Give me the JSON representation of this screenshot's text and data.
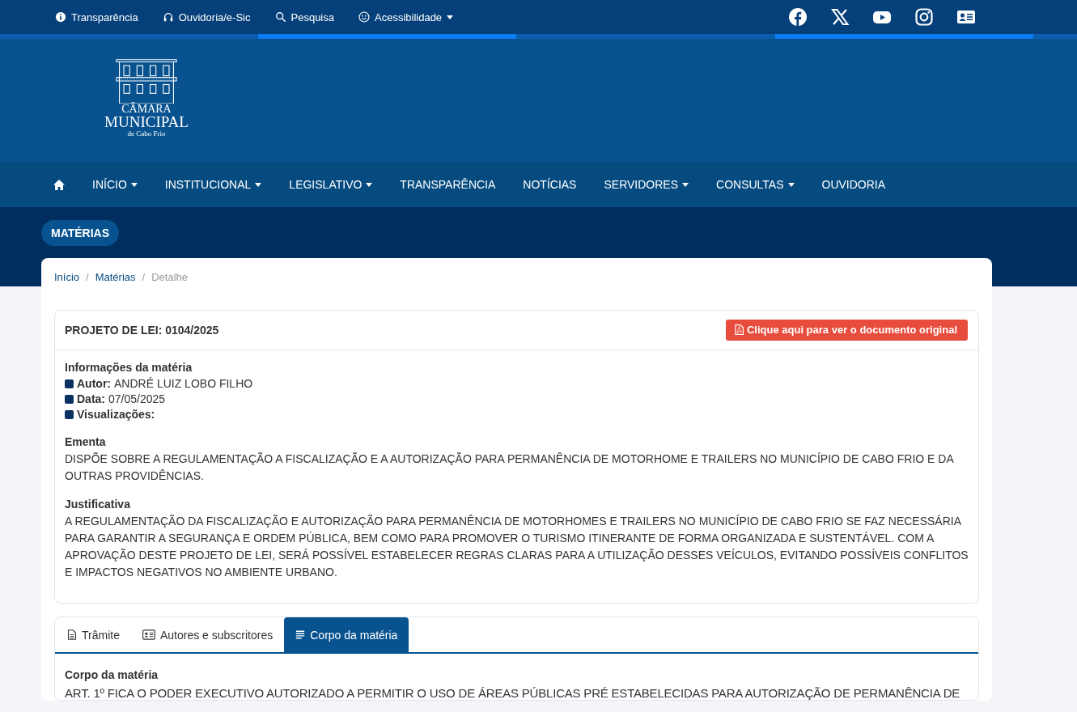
{
  "top_links": [
    {
      "kind": "info",
      "label": "Transparência",
      "has_dropdown": false
    },
    {
      "kind": "headset",
      "label": "Ouvidoria/e-Sic",
      "has_dropdown": false
    },
    {
      "kind": "search",
      "label": "Pesquisa",
      "has_dropdown": false
    },
    {
      "kind": "smile",
      "label": "Acessibilidade",
      "has_dropdown": true
    }
  ],
  "social": [
    {
      "kind": "facebook"
    },
    {
      "kind": "x"
    },
    {
      "kind": "youtube"
    },
    {
      "kind": "instagram"
    },
    {
      "kind": "contact-card"
    }
  ],
  "logo": {
    "line_1": "CÂMARA",
    "line_2": "MUNICIPAL",
    "line_3": "de Cabo Frio"
  },
  "nav": [
    {
      "label": "INÍCIO",
      "has_dropdown": true
    },
    {
      "label": "INSTITUCIONAL",
      "has_dropdown": true
    },
    {
      "label": "LEGISLATIVO",
      "has_dropdown": true
    },
    {
      "label": "TRANSPARÊNCIA",
      "has_dropdown": false
    },
    {
      "label": "NOTÍCIAS",
      "has_dropdown": false
    },
    {
      "label": "SERVIDORES",
      "has_dropdown": true
    },
    {
      "label": "CONSULTAS",
      "has_dropdown": true
    },
    {
      "label": "OUVIDORIA",
      "has_dropdown": false
    }
  ],
  "page_badge": "MATÉRIAS",
  "breadcrumb": [
    {
      "label": "Início",
      "current": false
    },
    {
      "label": "Matérias",
      "current": false
    },
    {
      "label": "Detalhe",
      "current": true
    }
  ],
  "breadcrumb_separator": "/",
  "materia": {
    "title": "PROJETO DE LEI: 0104/2025",
    "document_button": "Clique aqui para ver o documento original",
    "info_heading": "Informações da matéria",
    "info": [
      {
        "label": "Autor:",
        "value": "ANDRÉ LUIZ LOBO FILHO"
      },
      {
        "label": "Data:",
        "value": "07/05/2025"
      },
      {
        "label": "Visualizações:"
      }
    ],
    "sections": [
      {
        "heading": "Ementa",
        "text": "DISPÕE SOBRE A REGULAMENTAÇÃO A FISCALIZAÇÃO E A AUTORIZAÇÃO PARA PERMANÊNCIA DE MOTORHOME E TRAILERS NO MUNICÍPIO DE CABO FRIO E DA OUTRAS PROVIDÊNCIAS."
      },
      {
        "heading": "Justificativa",
        "text": "A REGULAMENTAÇÃO DA FISCALIZAÇÃO E AUTORIZAÇÃO PARA PERMANÊNCIA DE MOTORHOMES E TRAILERS NO MUNICÍPIO DE CABO FRIO SE FAZ NECESSÁRIA PARA GARANTIR A SEGURANÇA E ORDEM PÚBLICA, BEM COMO PARA PROMOVER O TURISMO ITINERANTE DE FORMA ORGANIZADA E SUSTENTÁVEL. COM A APROVAÇÃO DESTE PROJETO DE LEI, SERÁ POSSÍVEL ESTABELECER REGRAS CLARAS PARA A UTILIZAÇÃO DESSES VEÍCULOS, EVITANDO POSSÍVEIS CONFLITOS E IMPACTOS NEGATIVOS NO AMBIENTE URBANO."
      }
    ]
  },
  "tabs": [
    {
      "kind": "document",
      "label": "Trâmite",
      "selected": false
    },
    {
      "kind": "id-card",
      "label": "Autores e subscritores",
      "selected": false
    },
    {
      "kind": "lines",
      "label": "Corpo da matéria",
      "selected": true
    }
  ],
  "tab_content": {
    "heading": "Corpo da matéria",
    "text": "ART. 1º FICA O PODER EXECUTIVO AUTORIZADO A PERMITIR O USO DE ÁREAS PÚBLICAS PRÉ ESTABELECIDAS PARA AUTORIZAÇÃO DE PERMANÊNCIA DE"
  }
}
